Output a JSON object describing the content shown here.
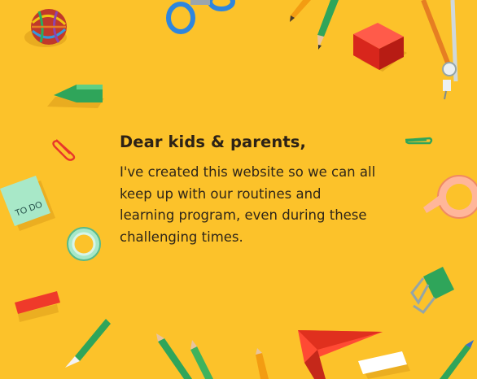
{
  "letter": {
    "greeting": "Dear kids & parents,",
    "message": "I've created this website so we can all keep up with our routines and learning program, even during these challenging times."
  },
  "notes": {
    "todo_label": "TO DO"
  },
  "colors": {
    "background": "#fcc22a",
    "text": "#2d2216",
    "accent_red": "#e8372a",
    "accent_green": "#2fa55a",
    "accent_blue": "#2f6fc4"
  },
  "icons": [
    "rubber-band-ball-icon",
    "scissors-icon",
    "pencil-icon",
    "eraser-icon",
    "compass-icon",
    "paper-clip-icon",
    "sticky-note-icon",
    "tape-roll-icon",
    "binder-clip-icon",
    "paper-plane-icon"
  ]
}
